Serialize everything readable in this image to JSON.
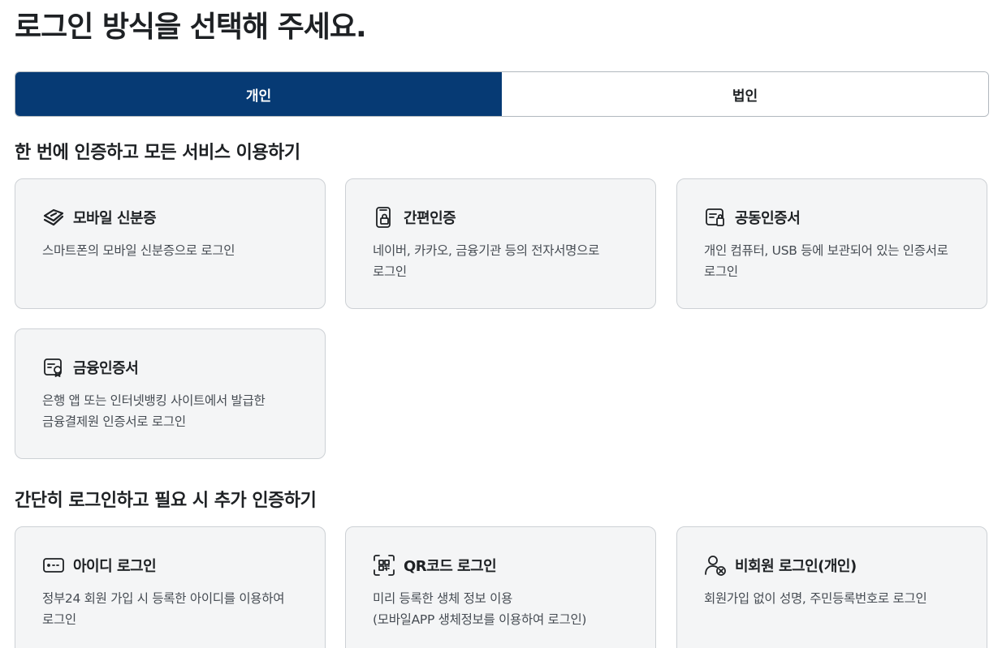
{
  "page_title": "로그인 방식을 선택해 주세요.",
  "tabs": [
    {
      "label": "개인",
      "active": true
    },
    {
      "label": "법인",
      "active": false
    }
  ],
  "sections": [
    {
      "title": "한 번에 인증하고 모든 서비스 이용하기",
      "cards": [
        {
          "icon": "mobile-id-icon",
          "title": "모바일 신분증",
          "desc_lines": [
            "스마트폰의 모바일 신분증으로 로그인"
          ]
        },
        {
          "icon": "simple-auth-icon",
          "title": "간편인증",
          "desc_lines": [
            "네이버, 카카오, 금융기관 등의 전자서명으로",
            "로그인"
          ]
        },
        {
          "icon": "joint-certificate-icon",
          "title": "공동인증서",
          "desc_lines": [
            "개인 컴퓨터, USB 등에 보관되어 있는 인증서로",
            "로그인"
          ]
        },
        {
          "icon": "financial-certificate-icon",
          "title": "금융인증서",
          "desc_lines": [
            "은행 앱 또는 인터넷뱅킹 사이트에서 발급한",
            "금융결제원 인증서로 로그인"
          ]
        }
      ]
    },
    {
      "title": "간단히 로그인하고 필요 시 추가 인증하기",
      "cards": [
        {
          "icon": "id-login-icon",
          "title": "아이디 로그인",
          "desc_lines": [
            "정부24 회원 가입 시 등록한 아이디를 이용하여",
            "로그인"
          ]
        },
        {
          "icon": "qr-code-icon",
          "title": "QR코드 로그인",
          "desc_lines": [
            "미리 등록한 생체 정보 이용",
            "(모바일APP 생체정보를 이용하여 로그인)"
          ]
        },
        {
          "icon": "non-member-icon",
          "title": "비회원 로그인(개인)",
          "desc_lines": [
            "회원가입 없이 성명, 주민등록번호로 로그인"
          ]
        }
      ]
    }
  ],
  "colors": {
    "primary": "#063a74",
    "card_bg": "#f4f5f6",
    "card_border": "#cdd1d5",
    "text": "#1e2124",
    "subtext": "#464c53"
  }
}
